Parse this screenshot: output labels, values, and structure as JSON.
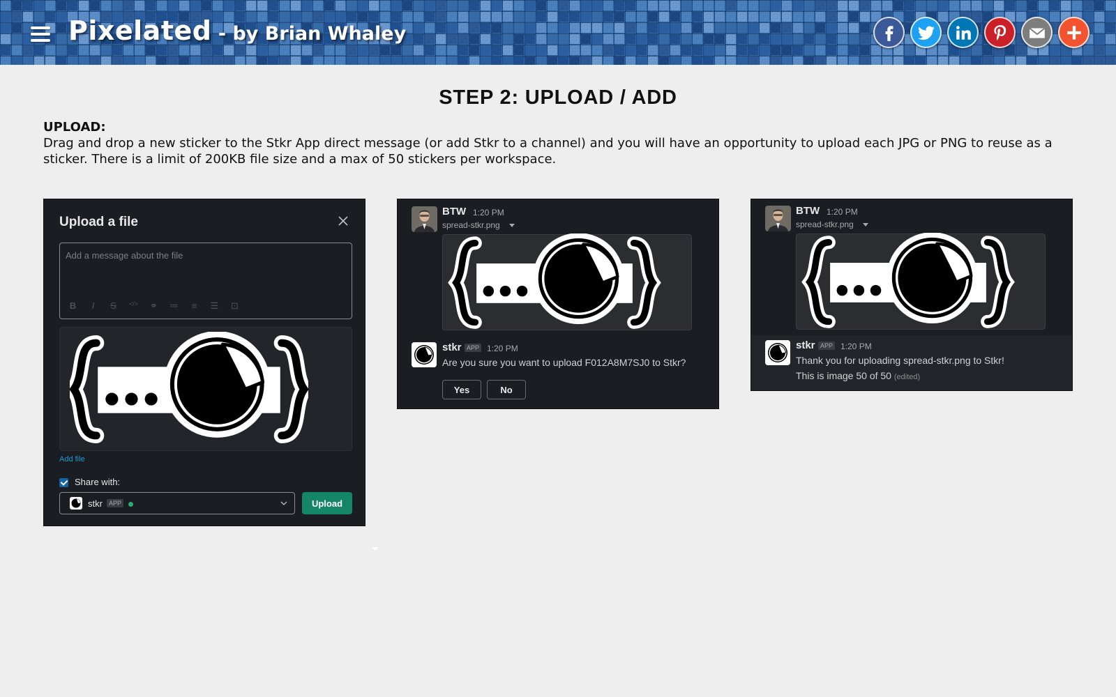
{
  "header": {
    "site_name": "Pixelated",
    "byline": " - by Brian Whaley",
    "share_icons": [
      "facebook-icon",
      "twitter-icon",
      "linkedin-icon",
      "pinterest-icon",
      "email-icon",
      "plus-icon"
    ],
    "share_colors": {
      "facebook": "#3b5998",
      "twitter": "#1da1f2",
      "linkedin": "#0077b5",
      "pinterest": "#cb2027",
      "email": "#7d7d7d",
      "more": "#f4532f"
    }
  },
  "content": {
    "step_title": "STEP 2: UPLOAD / ADD",
    "section_label": "UPLOAD:",
    "section_text": "Drag and drop a new sticker to the Stkr App direct message (or add Stkr to a channel) and you will have an opportunity to upload each JPG or PNG to reuse as a sticker. There is a limit of 200KB file size and a max of 50 stickers per workspace."
  },
  "upload_dialog": {
    "title": "Upload a file",
    "message_placeholder": "Add a message about the file",
    "format_tools": [
      "B",
      "I",
      "S",
      "</>",
      "link",
      "ol",
      "ul",
      "quote",
      "code"
    ],
    "add_file": "Add file",
    "share_with": "Share with:",
    "share_checked": true,
    "share_target": "stkr",
    "share_target_tag": "APP",
    "upload_button": "Upload"
  },
  "confirm_panel": {
    "user": "BTW",
    "user_time": "1:20 PM",
    "file_name": "spread-stkr.png",
    "bot_name": "stkr",
    "bot_tag": "APP",
    "bot_time": "1:20 PM",
    "bot_message": "Are you sure you want to upload F012A8M7SJ0 to Stkr?",
    "yes_button": "Yes",
    "no_button": "No"
  },
  "thanks_panel": {
    "user": "BTW",
    "user_time": "1:20 PM",
    "file_name": "spread-stkr.png",
    "bot_name": "stkr",
    "bot_tag": "APP",
    "bot_time": "1:20 PM",
    "bot_message_line1": "Thank you for uploading spread-stkr.png to Stkr!",
    "bot_message_line2": "This is image 50 of 50",
    "edited_label": "(edited)"
  },
  "colors": {
    "slack_dark": "#1a1d21",
    "upload_green": "#148567",
    "link_blue": "#1d9bd1",
    "header_blue": "#2f5f9c"
  }
}
